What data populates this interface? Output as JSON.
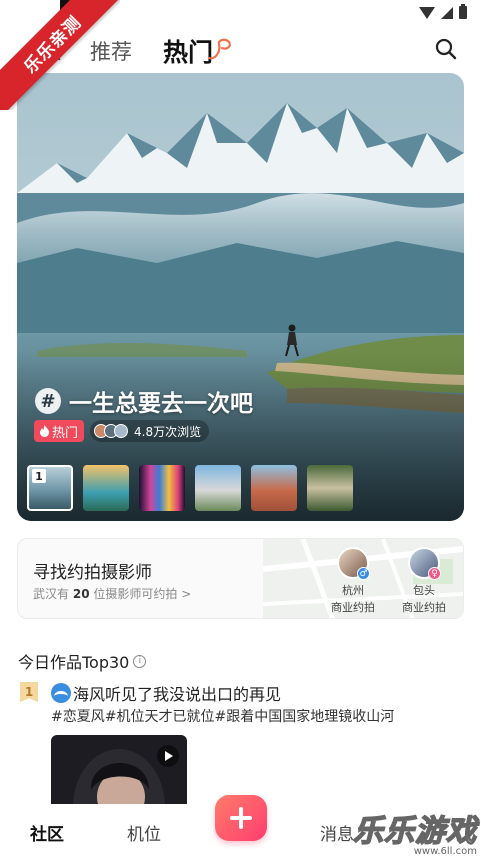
{
  "watermark": {
    "ribbon_text": "乐乐亲测",
    "brand": "乐乐游戏",
    "url": "www.6ll.com"
  },
  "top_nav": {
    "tabs": [
      {
        "label": "注",
        "partial": true
      },
      {
        "label": "推荐"
      },
      {
        "label": "热门",
        "active": true
      }
    ],
    "search_icon": "search-icon"
  },
  "hero": {
    "title": "一生总要去一次吧",
    "hash_symbol": "#",
    "hot_label": "热门",
    "views": "4.8万次浏览",
    "active_index": "1",
    "thumb_count": 6
  },
  "photographer": {
    "title": "寻找约拍摄影师",
    "sub_prefix": "武汉有",
    "count": "20",
    "sub_suffix": "位摄影师可约拍",
    "chevron": ">",
    "people": [
      {
        "city": "杭州",
        "type": "商业约拍",
        "gender": "♂",
        "gender_color": "#3a8ee0"
      },
      {
        "city": "包头",
        "type": "商业约拍",
        "gender": "♀",
        "gender_color": "#f05a8a"
      }
    ]
  },
  "top30": {
    "title": "今日作品Top30",
    "info_icon": "i",
    "item": {
      "rank": "1",
      "title": "海风听见了我没说出口的再见",
      "tags": "#恋夏风#机位天才已就位#跟着中国国家地理镜收山河"
    }
  },
  "bottom_nav": {
    "items": [
      {
        "label": "社区",
        "active": true
      },
      {
        "label": "机位"
      },
      {
        "label": "消息"
      }
    ],
    "add_icon": "plus-icon"
  },
  "colors": {
    "accent": "#f04a5c",
    "fab_start": "#ff7c6a",
    "fab_end": "#ff3d6f",
    "ribbon": "#d8252b"
  }
}
